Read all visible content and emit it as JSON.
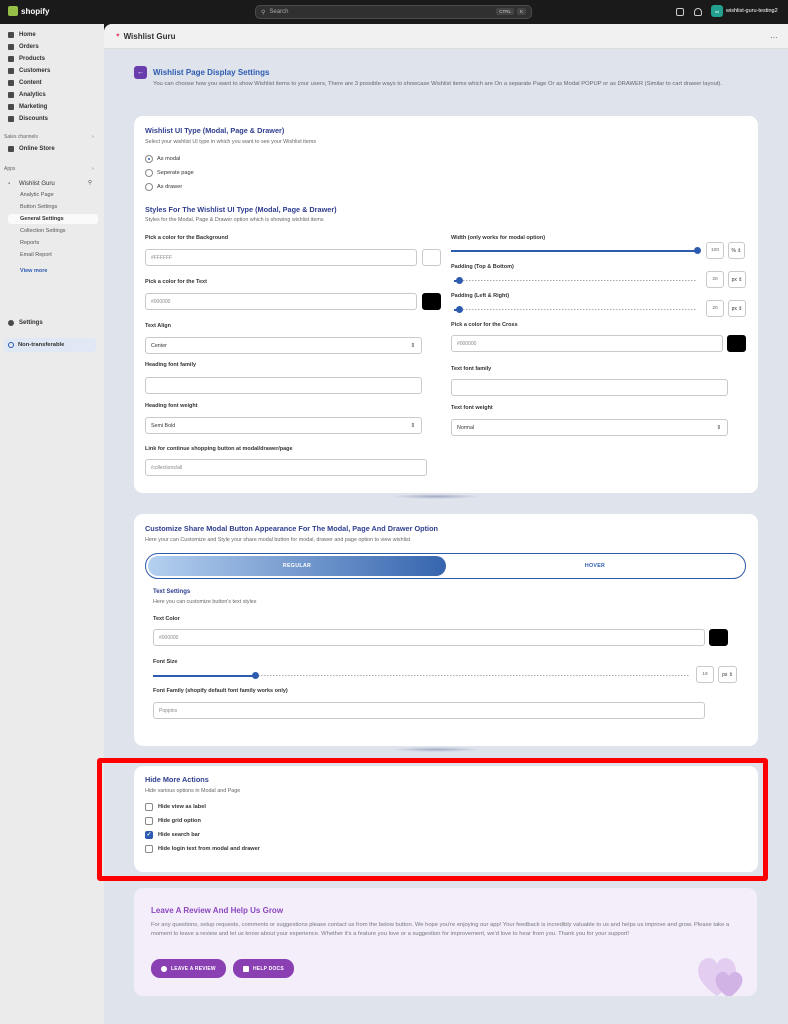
{
  "topbar": {
    "brand": "shopify",
    "search_placeholder": "Search",
    "shortcut_keys": [
      "CTRL",
      "K"
    ],
    "store_initials": "wi",
    "store_name": "wishlist-guru-testing2"
  },
  "sidebar": {
    "nav": [
      "Home",
      "Orders",
      "Products",
      "Customers",
      "Content",
      "Analytics",
      "Marketing",
      "Discounts"
    ],
    "sales_channels_label": "Sales channels",
    "online_store": "Online Store",
    "apps_label": "Apps",
    "app_name": "Wishlist Guru",
    "app_sub": [
      "Analytic Page",
      "Button Settings",
      "General Settings",
      "Collection Settings",
      "Reports",
      "Email Report"
    ],
    "view_more": "View more",
    "settings": "Settings",
    "non_transferable": "Non-transferable"
  },
  "app_header": {
    "title": "Wishlist Guru",
    "more": "···"
  },
  "page": {
    "title": "Wishlist Page Display Settings",
    "description": "You can choose how you want to show Wishlist items to your users, There are 3 possible ways to showcase Wishlist items which are On a separate Page Or as Modal POPUP or as DRAWER (Similar to cart drawer layout)."
  },
  "ui_type": {
    "title": "Wishlist UI Type (Modal, Page & Drawer)",
    "subtitle": "Select your wishlist UI type in which you want to see your Wishlist items",
    "options": [
      "As modal",
      "Seperate page",
      "As drawer"
    ],
    "selected": "As modal"
  },
  "styles": {
    "title": "Styles For The Wishlist UI Type (Modal, Page & Drawer)",
    "subtitle": "Styles for the Modal, Page & Drawer option which is showing wishlist items",
    "bg_label": "Pick a color for the Background",
    "bg_value": "#FFFFFF",
    "text_color_label": "Pick a color for the Text",
    "text_color_value": "#000000",
    "text_align_label": "Text Align",
    "text_align_value": "Center",
    "heading_font_family_label": "Heading font family",
    "heading_font_family_value": "",
    "heading_font_weight_label": "Heading font weight",
    "heading_font_weight_value": "Semi Bold",
    "link_label": "Link for continue shopping button at modal/drawer/page",
    "link_value": "/collections/all",
    "width_label": "Width (only works for modal option)",
    "width_value": "100",
    "width_unit": "%",
    "width_fraction": 1.0,
    "pad_tb_label": "Padding (Top & Bottom)",
    "pad_tb_value": "20",
    "pad_tb_unit": "px",
    "pad_tb_fraction": 0.02,
    "pad_lr_label": "Padding (Left & Right)",
    "pad_lr_value": "20",
    "pad_lr_unit": "px",
    "pad_lr_fraction": 0.02,
    "cross_label": "Pick a color for the Cross",
    "cross_value": "#000000",
    "text_font_family_label": "Text font family",
    "text_font_family_value": "",
    "text_font_weight_label": "Text font weight",
    "text_font_weight_value": "Normal"
  },
  "share": {
    "title": "Customize Share Modal Button Appearance For The Modal, Page And Drawer Option",
    "subtitle": "Here your can Customize and Style your share modal button for modal, drawer and page option to view wishlist",
    "tab_regular": "REGULAR",
    "tab_hover": "HOVER",
    "text_settings_title": "Text Settings",
    "text_settings_sub": "Here you can customize button's text styles",
    "text_color_label": "Text Color",
    "text_color_value": "#000000",
    "font_size_label": "Font Size",
    "font_size_value": "19",
    "font_size_unit": "px",
    "font_size_fraction": 0.19,
    "font_family_label": "Font Family (shopify default font family works only)",
    "font_family_value": "Poppins"
  },
  "hide": {
    "title": "Hide More Actions",
    "subtitle": "Hide various options in Modal and Page",
    "options": [
      {
        "label": "Hide view as label",
        "checked": false
      },
      {
        "label": "Hide grid option",
        "checked": false
      },
      {
        "label": "Hide search bar",
        "checked": true
      },
      {
        "label": "Hide login text from modal and drawer",
        "checked": false
      }
    ]
  },
  "review": {
    "title": "Leave A Review And Help Us Grow",
    "text": "For any questions, setup requests, comments or suggestions please contact us from the below button. We hope you're enjoying our app! Your feedback is incredibly valuable to us and helps us improve and grow. Please take a moment to leave a review and let us know about your experience. Whether it's a feature you love or a suggestion for improvement, we'd love to hear from you. Thank you for your support!",
    "btn_review": "LEAVE A REVIEW",
    "btn_docs": "HELP DOCS"
  },
  "colors": {
    "accent": "#2c5bb0",
    "purple": "#8a3fb3",
    "highlight": "#ff0000"
  }
}
